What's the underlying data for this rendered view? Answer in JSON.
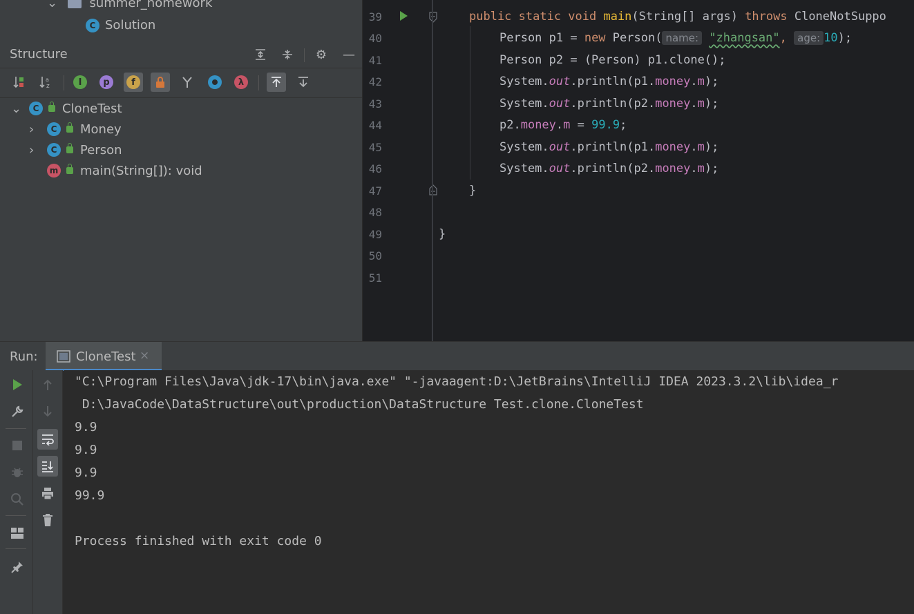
{
  "project": {
    "folder": "summer_homework",
    "file": "Solution"
  },
  "structure": {
    "title": "Structure",
    "tree": {
      "root": "CloneTest",
      "children": [
        {
          "label": "Money",
          "kind": "class"
        },
        {
          "label": "Person",
          "kind": "class"
        },
        {
          "label": "main(String[]): void",
          "kind": "method"
        }
      ]
    }
  },
  "editor": {
    "line_numbers": [
      "39",
      "40",
      "41",
      "42",
      "43",
      "44",
      "45",
      "46",
      "47",
      "48",
      "49",
      "50",
      "51"
    ],
    "colors": {
      "keyword": "#cf8e6d",
      "string": "#6aab73",
      "number": "#2aacb8",
      "field": "#c77dbb",
      "method": "#e8ba36"
    },
    "lines": {
      "l39": {
        "kw1": "public static void ",
        "fn": "main",
        "rest": "(String[] args) ",
        "kw2": "throws ",
        "tail": "CloneNotSuppo"
      },
      "l40": {
        "a": "Person p1 = ",
        "kw": "new ",
        "b": "Person(",
        "hint1": "name:",
        "str": "\"zhangsan\"",
        "c": ", ",
        "hint2": "age:",
        "num": "10",
        "d": ");"
      },
      "l41": {
        "a": "Person p2 = (Person) p1.clone();"
      },
      "l42": {
        "a": "System.",
        "it": "out",
        "b": ".println(p1.",
        "fld1": "money",
        "c": ".",
        "fld2": "m",
        "d": ");"
      },
      "l43": {
        "a": "System.",
        "it": "out",
        "b": ".println(p2.",
        "fld1": "money",
        "c": ".",
        "fld2": "m",
        "d": ");"
      },
      "l44": {
        "a": "p2.",
        "fld1": "money",
        "b": ".",
        "fld2": "m",
        "c": " = ",
        "num": "99.9",
        "d": ";"
      },
      "l45": {
        "a": "System.",
        "it": "out",
        "b": ".println(p1.",
        "fld1": "money",
        "c": ".",
        "fld2": "m",
        "d": ");"
      },
      "l46": {
        "a": "System.",
        "it": "out",
        "b": ".println(p2.",
        "fld1": "money",
        "c": ".",
        "fld2": "m",
        "d": ");"
      },
      "l47": {
        "a": "}"
      },
      "l49": {
        "a": "}"
      }
    }
  },
  "run": {
    "label": "Run:",
    "tab": "CloneTest",
    "output": [
      "\"C:\\Program Files\\Java\\jdk-17\\bin\\java.exe\" \"-javaagent:D:\\JetBrains\\IntelliJ IDEA 2023.3.2\\lib\\idea_r",
      " D:\\JavaCode\\DataStructure\\out\\production\\DataStructure Test.clone.CloneTest",
      "9.9",
      "9.9",
      "9.9",
      "99.9",
      "",
      "Process finished with exit code 0"
    ]
  }
}
